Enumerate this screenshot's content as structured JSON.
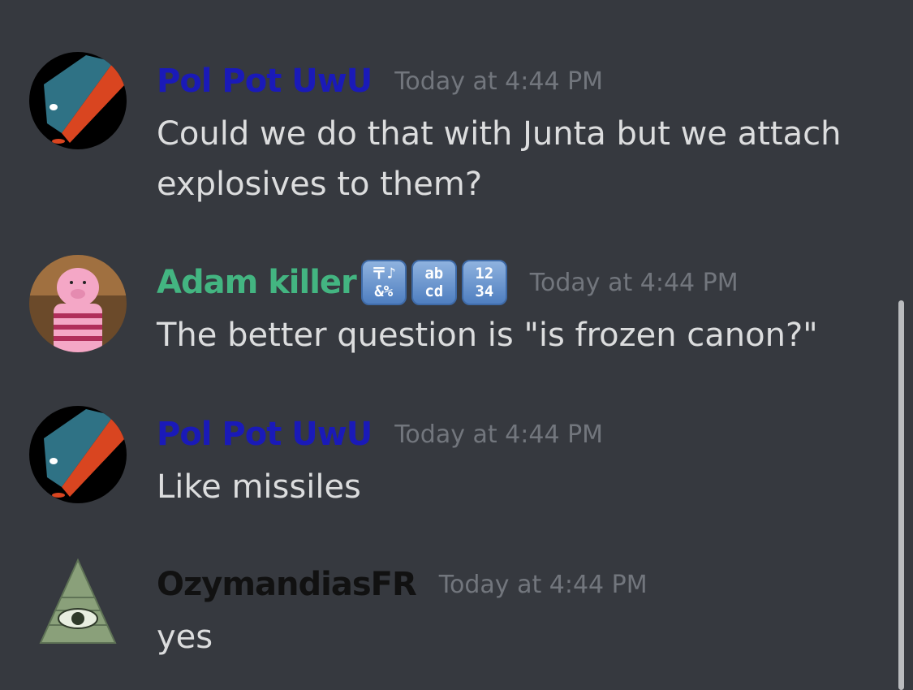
{
  "messages": [
    {
      "username": "Pol Pot UwU",
      "username_color": "#1a1ab8",
      "timestamp": "Today at 4:44 PM",
      "lines": [
        "Could we do that with Junta but we attach",
        "explosives to them?"
      ]
    },
    {
      "username": "Adam killer",
      "username_color": "#43b581",
      "timestamp": "Today at 4:44 PM",
      "badges": [
        {
          "icon": "symbols-input-icon",
          "top": "〒♪",
          "bottom": "&%"
        },
        {
          "icon": "latin-letters-input-icon",
          "top": "ab",
          "bottom": "cd"
        },
        {
          "icon": "numbers-input-icon",
          "top": "12",
          "bottom": "34"
        }
      ],
      "lines": [
        "The better question is \"is frozen canon?\""
      ]
    },
    {
      "username": "Pol Pot UwU",
      "username_color": "#1a1ab8",
      "timestamp": "Today at 4:44 PM",
      "lines": [
        "Like missiles"
      ]
    },
    {
      "username": "OzymandiasFR",
      "username_color": "#111111",
      "timestamp": "Today at 4:44 PM",
      "lines": [
        "yes"
      ]
    }
  ],
  "colors": {
    "background": "#36393f",
    "message_text": "#dcddde",
    "timestamp": "#72767d",
    "scrollbar": "#b9bbbe"
  }
}
